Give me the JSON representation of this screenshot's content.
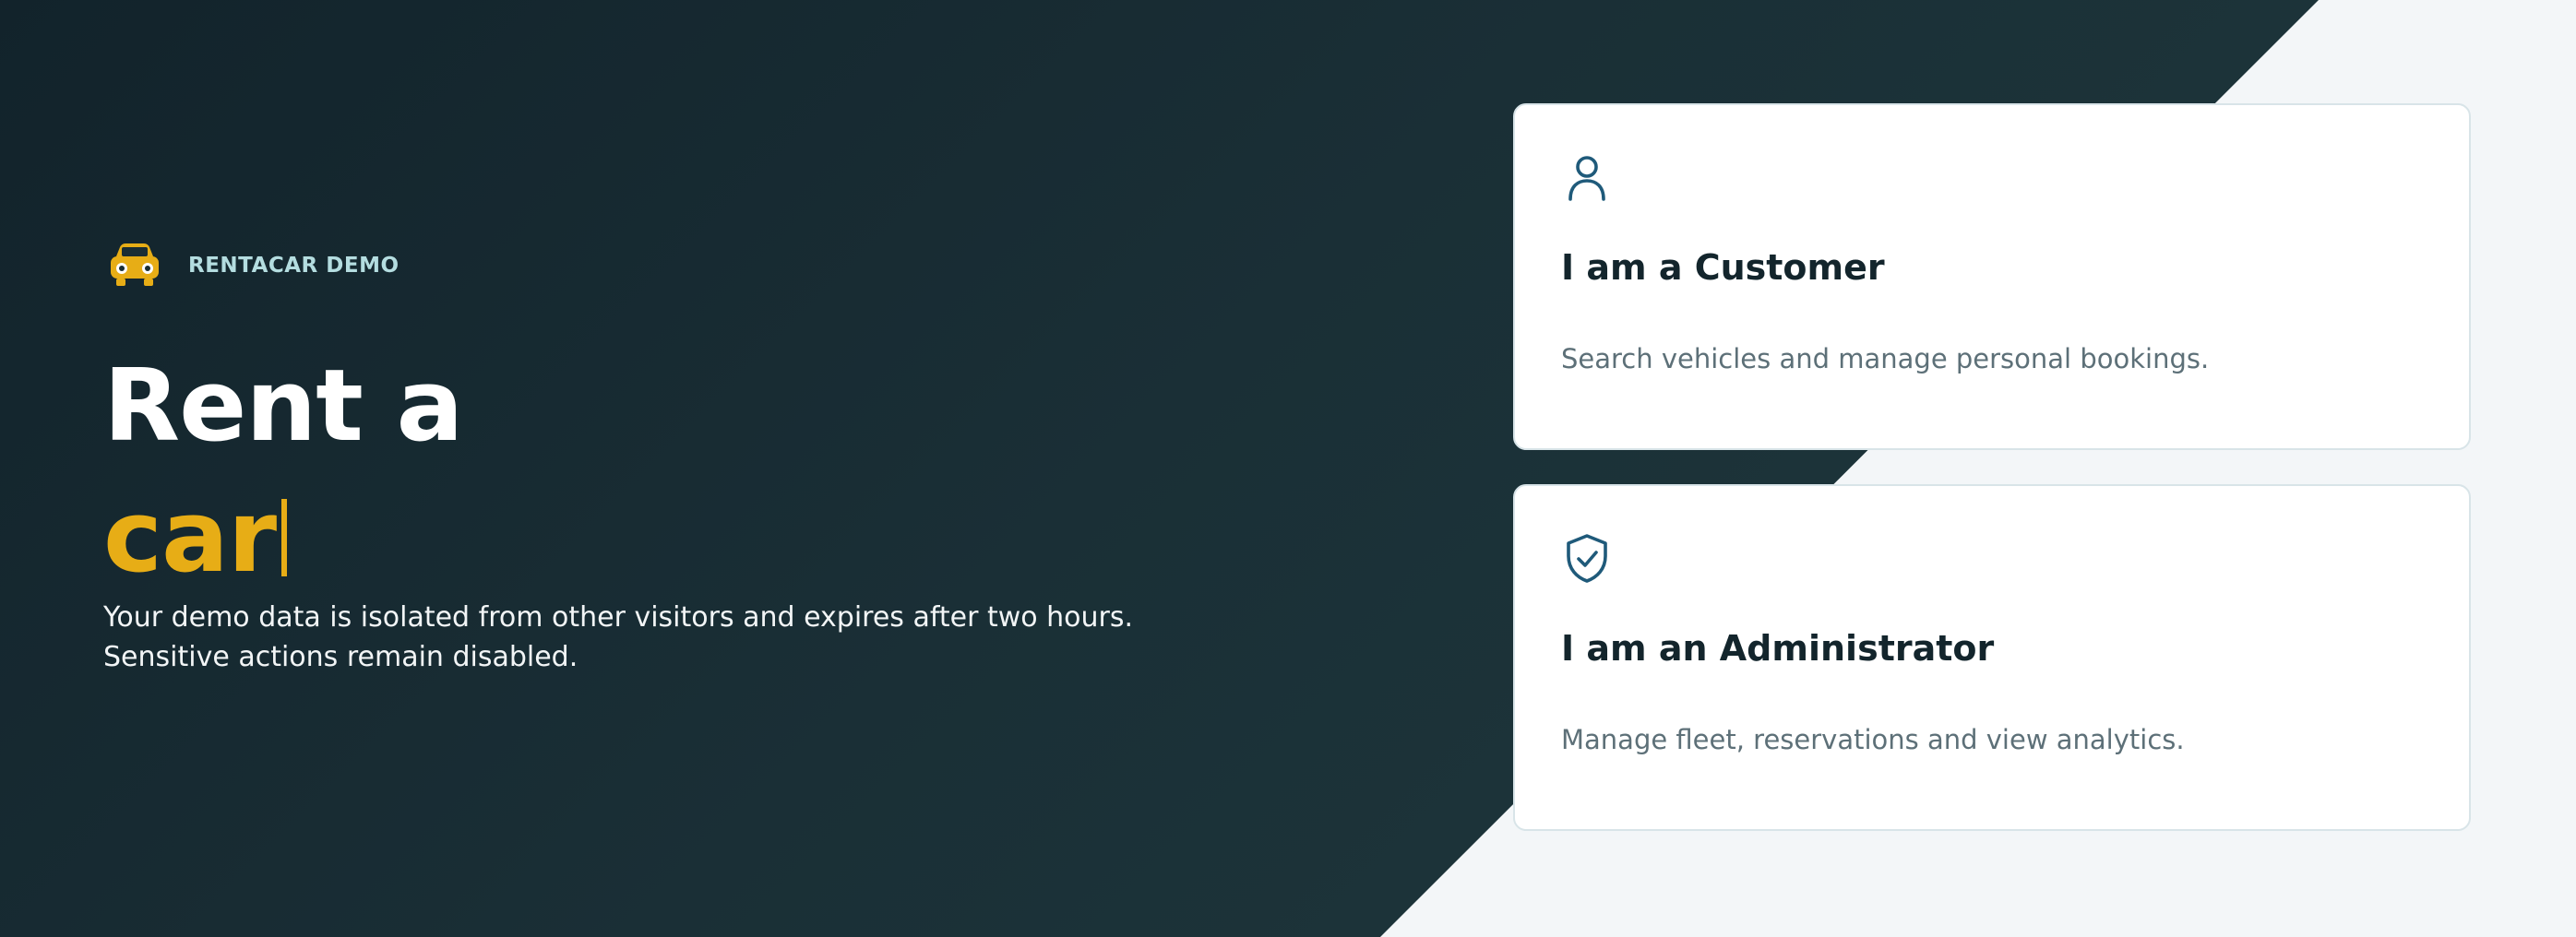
{
  "brand": {
    "name": "RENTACAR DEMO",
    "logo_icon": "car-icon",
    "logo_color": "#e7ad16"
  },
  "hero": {
    "title_line1": "Rent a",
    "title_line2": "car",
    "description": "Your demo data is isolated from other visitors and expires after two hours. Sensitive actions remain disabled."
  },
  "roles": [
    {
      "icon": "user-icon",
      "title": "I am a Customer",
      "description": "Search vehicles and manage personal bookings."
    },
    {
      "icon": "shield-check-icon",
      "title": "I am an Administrator",
      "description": "Manage fleet, reservations and view analytics."
    }
  ],
  "colors": {
    "dark_background": "#15282f",
    "accent": "#e7ad16",
    "icon": "#1f5a7a",
    "light_background": "#f3f6f8"
  }
}
